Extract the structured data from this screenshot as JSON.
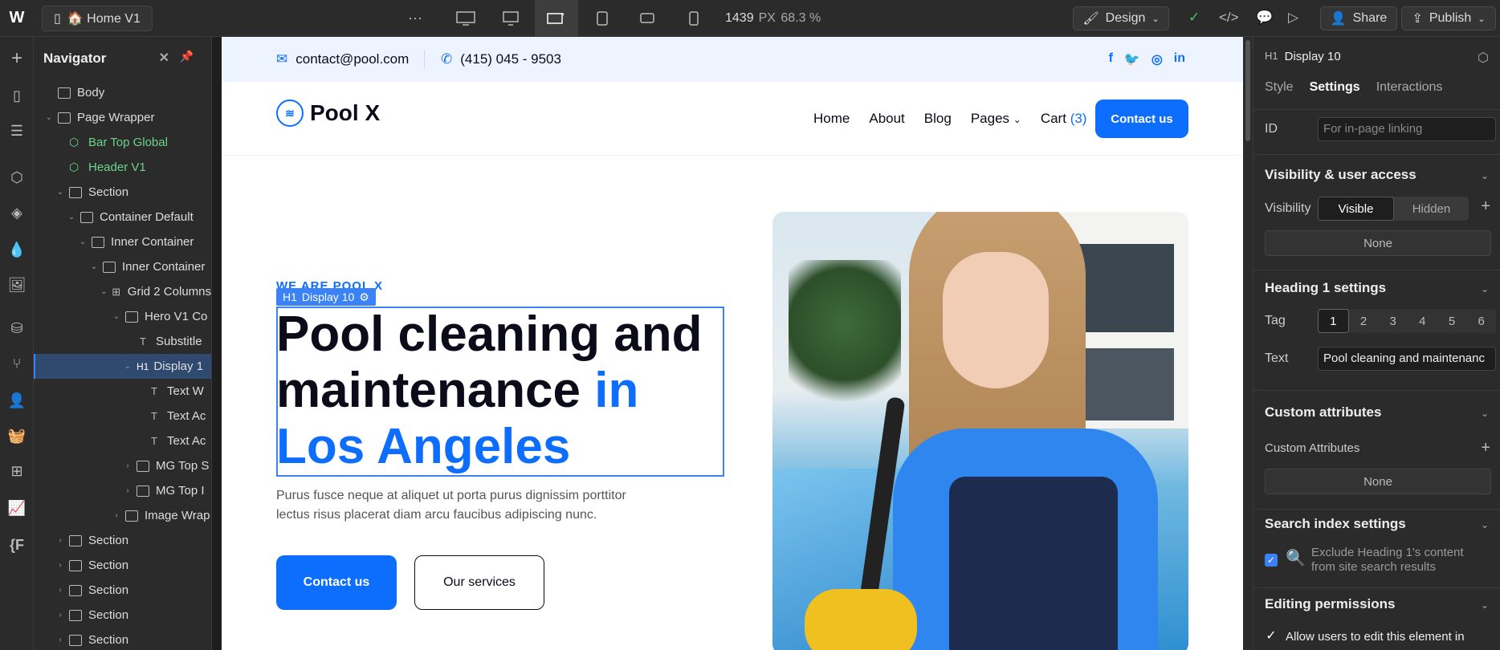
{
  "topbar": {
    "page_name": "🏠 Home V1",
    "more": "···",
    "width_value": "1439",
    "unit": "PX",
    "zoom": "68.3 %",
    "design_label": "Design",
    "share_label": "Share",
    "publish_label": "Publish"
  },
  "navigator": {
    "title": "Navigator",
    "nodes": [
      {
        "label": "Body"
      },
      {
        "label": "Page Wrapper"
      },
      {
        "label": "Bar Top Global"
      },
      {
        "label": "Header V1"
      },
      {
        "label": "Section"
      },
      {
        "label": "Container Default"
      },
      {
        "label": "Inner Container"
      },
      {
        "label": "Inner Container"
      },
      {
        "label": "Grid 2 Columns"
      },
      {
        "label": "Hero V1 Co"
      },
      {
        "label": "Substitle"
      },
      {
        "label": "Display 1"
      },
      {
        "label": "Text W"
      },
      {
        "label": "Text Ac"
      },
      {
        "label": "Text Ac"
      },
      {
        "label": "MG Top S"
      },
      {
        "label": "MG Top I"
      },
      {
        "label": "Image Wrap"
      },
      {
        "label": "Section"
      },
      {
        "label": "Section"
      },
      {
        "label": "Section"
      },
      {
        "label": "Section"
      },
      {
        "label": "Section"
      }
    ]
  },
  "site": {
    "email": "contact@pool.com",
    "phone": "(415) 045 - 9503",
    "brand": "Pool X",
    "menu": [
      "Home",
      "About",
      "Blog",
      "Pages"
    ],
    "cart_label": "Cart",
    "cart_count": "(3)",
    "header_cta": "Contact us",
    "eyebrow": "WE ARE POOL X",
    "selection_tag": "Display 10",
    "hero_line1": "Pool cleaning and",
    "hero_line2a": "maintenance ",
    "hero_line2b": "in",
    "hero_line3": "Los Angeles",
    "hero_text": "Purus fusce neque at aliquet ut porta purus dignissim porttitor lectus risus placerat diam arcu faucibus adipiscing nunc.",
    "btn_primary": "Contact us",
    "btn_secondary": "Our services"
  },
  "panel": {
    "element_type": "H1",
    "element_name": "Display 10",
    "tabs": [
      "Style",
      "Settings",
      "Interactions"
    ],
    "id_label": "ID",
    "id_placeholder": "For in-page linking",
    "visibility_section": "Visibility & user access",
    "visibility_label": "Visibility",
    "visible": "Visible",
    "hidden": "Hidden",
    "none1": "None",
    "heading_section": "Heading 1 settings",
    "tag_label": "Tag",
    "tags": [
      "1",
      "2",
      "3",
      "4",
      "5",
      "6"
    ],
    "text_label": "Text",
    "text_value": "Pool cleaning and maintenanc",
    "custom_section": "Custom attributes",
    "custom_label": "Custom Attributes",
    "none2": "None",
    "search_section": "Search index settings",
    "search_desc": "Exclude Heading 1's content from site search results",
    "editing_section": "Editing permissions",
    "editing_desc": "Allow users to edit this element in"
  }
}
